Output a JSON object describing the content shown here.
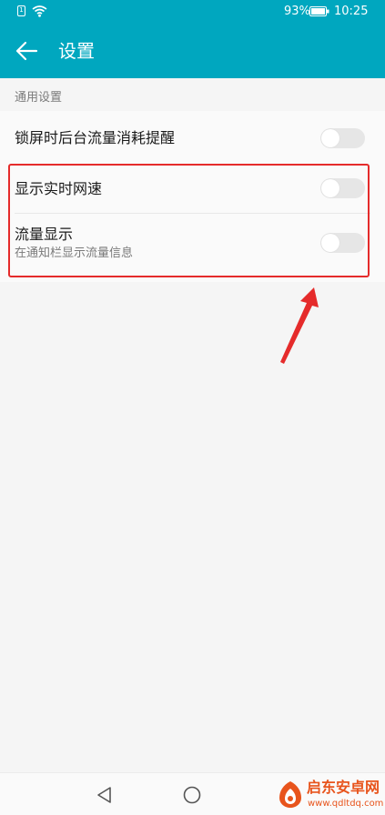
{
  "status_bar": {
    "battery_percent": "93%",
    "time": "10:25",
    "sim_label": "1"
  },
  "app_bar": {
    "title": "设置"
  },
  "section": {
    "header": "通用设置"
  },
  "settings": [
    {
      "title": "锁屏时后台流量消耗提醒",
      "enabled": false
    },
    {
      "title": "显示实时网速",
      "enabled": false
    },
    {
      "title": "流量显示",
      "subtitle": "在通知栏显示流量信息",
      "enabled": false
    }
  ],
  "watermark": {
    "title": "启东安卓网",
    "url": "www.qdltdq.com"
  },
  "colors": {
    "primary": "#00a7bf",
    "background": "#f5f5f5",
    "annotation": "#e52b2b",
    "toggle_off": "#e6e6e6",
    "watermark": "#e8541c"
  }
}
